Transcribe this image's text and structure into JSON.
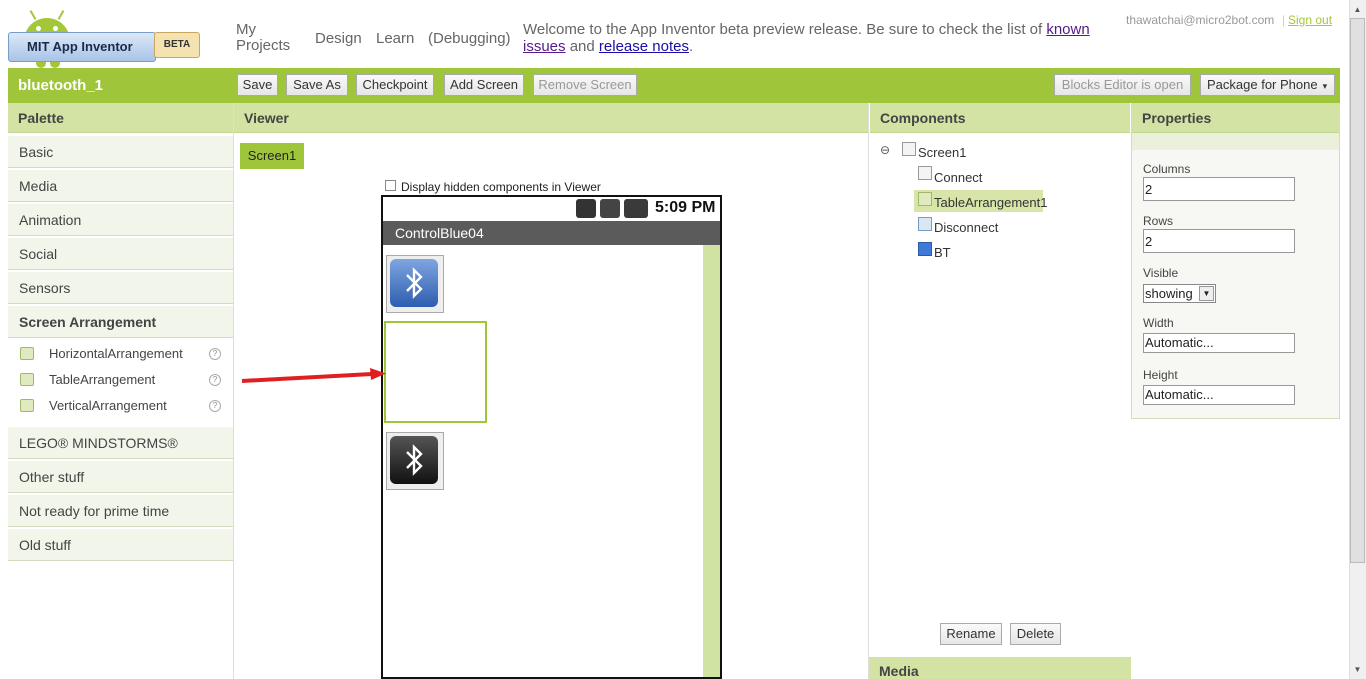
{
  "header": {
    "logo_text": "MIT App Inventor",
    "logo_badge": "BETA",
    "nav": {
      "my_projects": "My Projects",
      "design": "Design",
      "learn": "Learn",
      "debugging": "(Debugging)"
    },
    "welcome_prefix": "Welcome to the App Inventor beta preview release. Be sure to check the list of ",
    "known_issues": "known issues",
    "welcome_mid": " and ",
    "release_notes": "release notes",
    "welcome_suffix": ".",
    "user_email": "thawatchai@micro2bot.com",
    "separator": "|",
    "sign_out": "Sign out"
  },
  "toolbar": {
    "project_name": "bluetooth_1",
    "save": "Save",
    "save_as": "Save As",
    "checkpoint": "Checkpoint",
    "add_screen": "Add Screen",
    "remove_screen": "Remove Screen",
    "blocks_editor": "Blocks Editor is open",
    "package": "Package for Phone",
    "package_caret": "▾"
  },
  "palette": {
    "title": "Palette",
    "categories": [
      "Basic",
      "Media",
      "Animation",
      "Social",
      "Sensors",
      "Screen Arrangement",
      "LEGO® MINDSTORMS®",
      "Other stuff",
      "Not ready for prime time",
      "Old stuff"
    ],
    "items": [
      "HorizontalArrangement",
      "TableArrangement",
      "VerticalArrangement"
    ],
    "help_glyph": "?"
  },
  "viewer": {
    "title": "Viewer",
    "screen_tab": "Screen1",
    "hidden_components_label": "Display hidden components in Viewer",
    "status_time": "5:09 PM",
    "app_title": "ControlBlue04"
  },
  "components": {
    "title": "Components",
    "collapse_glyph": "⊖",
    "tree": [
      "Screen1",
      "Connect",
      "TableArrangement1",
      "Disconnect",
      "BT"
    ],
    "rename": "Rename",
    "delete": "Delete",
    "media_title": "Media"
  },
  "properties": {
    "title": "Properties",
    "columns_label": "Columns",
    "columns_value": "2",
    "rows_label": "Rows",
    "rows_value": "2",
    "visible_label": "Visible",
    "visible_value": "showing",
    "width_label": "Width",
    "width_value": "Automatic...",
    "height_label": "Height",
    "height_value": "Automatic..."
  },
  "colors": {
    "accent": "#9fc63b",
    "panel_header": "#d2e3a4",
    "arrow": "#e02020"
  }
}
